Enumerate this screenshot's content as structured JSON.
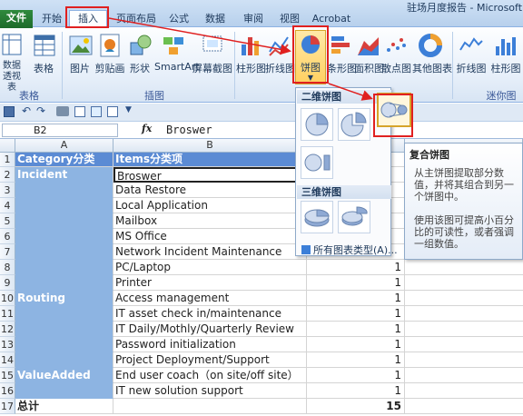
{
  "window": {
    "title": "驻场月度报告 - Microsoft Exc"
  },
  "tabs": [
    "文件",
    "开始",
    "插入",
    "页面布局",
    "公式",
    "数据",
    "审阅",
    "视图",
    "Acrobat"
  ],
  "ribbon": {
    "buttons": [
      "数据透视表",
      "表格",
      "图片",
      "剪贴画",
      "形状",
      "SmartArt",
      "屏幕截图",
      "柱形图",
      "折线图",
      "饼图",
      "条形图",
      "面积图",
      "散点图",
      "其他图表",
      "折线图",
      "柱形图"
    ],
    "groups": [
      "表格",
      "插图",
      "迷你图"
    ]
  },
  "formula_bar": {
    "name_box": "B2",
    "fx": "fx",
    "value": "Broswer"
  },
  "columns": [
    "A",
    "B"
  ],
  "sheet": {
    "header": {
      "category": "Category分类",
      "items": "Items分类项"
    },
    "rows": [
      {
        "n": "2",
        "cat": "Incident",
        "item": "Broswer",
        "val": ""
      },
      {
        "n": "3",
        "cat": "",
        "item": "Data Restore",
        "val": ""
      },
      {
        "n": "4",
        "cat": "",
        "item": "Local Application",
        "val": ""
      },
      {
        "n": "5",
        "cat": "",
        "item": "Mailbox",
        "val": ""
      },
      {
        "n": "6",
        "cat": "",
        "item": "MS Office",
        "val": ""
      },
      {
        "n": "7",
        "cat": "",
        "item": "Network Incident Maintenance",
        "val": ""
      },
      {
        "n": "8",
        "cat": "",
        "item": "PC/Laptop",
        "val": "1"
      },
      {
        "n": "9",
        "cat": "",
        "item": "Printer",
        "val": "1"
      },
      {
        "n": "10",
        "cat": "Routing",
        "item": "Access management",
        "val": "1"
      },
      {
        "n": "11",
        "cat": "",
        "item": "IT asset check in/maintenance",
        "val": "1"
      },
      {
        "n": "12",
        "cat": "",
        "item": "IT Daily/Mothly/Quarterly Review",
        "val": "1"
      },
      {
        "n": "13",
        "cat": "",
        "item": "Password initialization",
        "val": "1"
      },
      {
        "n": "14",
        "cat": "",
        "item": "Project Deployment/Support",
        "val": "1"
      },
      {
        "n": "15",
        "cat": "ValueAdded",
        "item": "End user coach（on site/off site）",
        "val": "1"
      },
      {
        "n": "16",
        "cat": "",
        "item": "IT new solution support",
        "val": "1"
      },
      {
        "n": "17",
        "cat": "总计",
        "item": "",
        "val": "15"
      }
    ]
  },
  "dropdown": {
    "section_2d": "二维饼图",
    "section_3d": "三维饼图",
    "all_types": "所有图表类型(A)..."
  },
  "tooltip": {
    "title": "复合饼图",
    "desc1": "从主饼图提取部分数值，并将其组合到另一个饼图中。",
    "desc2": "使用该图可提高小百分比的可读性，或者强调一组数值。"
  },
  "colors": {
    "accent": "#5b8bd4",
    "category_fill": "#8db4e2",
    "highlight": "#e02020"
  }
}
